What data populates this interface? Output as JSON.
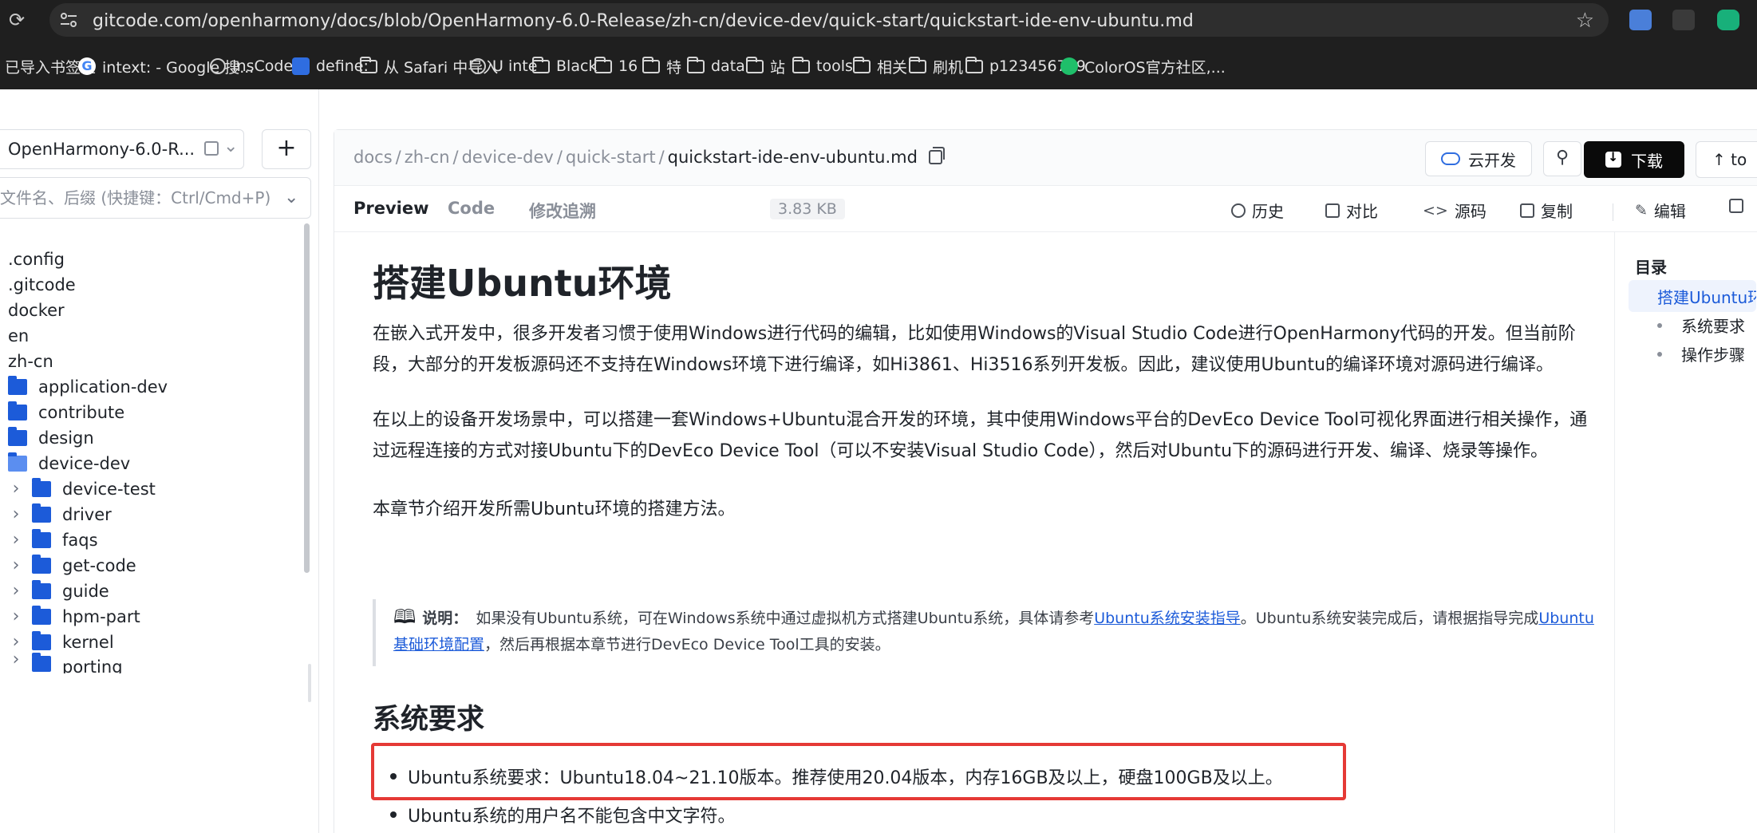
{
  "browser": {
    "url": "gitcode.com/openharmony/docs/blob/OpenHarmony-6.0-Release/zh-cn/device-dev/quick-start/quickstart-ide-env-ubuntu.md",
    "bookmarks": [
      {
        "label": "已导入书签栏",
        "icon": "none"
      },
      {
        "label": "intext: - Google 搜...",
        "icon": "google"
      },
      {
        "label": "InsCodeAI",
        "icon": "globe"
      },
      {
        "label": "define:",
        "icon": "dict"
      },
      {
        "label": "从 Safari 中导入",
        "icon": "folder"
      },
      {
        "label": "U inte",
        "icon": "globe"
      },
      {
        "label": "Black",
        "icon": "folder"
      },
      {
        "label": "16",
        "icon": "folder"
      },
      {
        "label": "特",
        "icon": "folder"
      },
      {
        "label": "data",
        "icon": "folder"
      },
      {
        "label": "站",
        "icon": "folder"
      },
      {
        "label": "tools",
        "icon": "folder"
      },
      {
        "label": "相关",
        "icon": "folder"
      },
      {
        "label": "刷机",
        "icon": "folder"
      },
      {
        "label": "p123456789",
        "icon": "folder"
      },
      {
        "label": "ColorOS官方社区,...",
        "icon": "coloros"
      }
    ]
  },
  "sidebar": {
    "repo_label": "OpenHarmony-6.0-R...",
    "add_label": "+",
    "search_placeholder": "文件名、后缀 (快捷键：Ctrl/Cmd+P)",
    "items": [
      {
        "label": ".config",
        "type": "file",
        "indent": 0
      },
      {
        "label": ".gitcode",
        "type": "file",
        "indent": 0
      },
      {
        "label": "docker",
        "type": "file",
        "indent": 0
      },
      {
        "label": "en",
        "type": "file",
        "indent": 0
      },
      {
        "label": "zh-cn",
        "type": "file",
        "indent": 0
      },
      {
        "label": "application-dev",
        "type": "folder",
        "indent": 0
      },
      {
        "label": "contribute",
        "type": "folder",
        "indent": 0
      },
      {
        "label": "design",
        "type": "folder",
        "indent": 0
      },
      {
        "label": "device-dev",
        "type": "folder-open",
        "indent": 0
      },
      {
        "label": "device-test",
        "type": "folder",
        "indent": 1
      },
      {
        "label": "driver",
        "type": "folder",
        "indent": 1
      },
      {
        "label": "faqs",
        "type": "folder",
        "indent": 1
      },
      {
        "label": "get-code",
        "type": "folder",
        "indent": 1
      },
      {
        "label": "guide",
        "type": "folder",
        "indent": 1
      },
      {
        "label": "hpm-part",
        "type": "folder",
        "indent": 1
      },
      {
        "label": "kernel",
        "type": "folder",
        "indent": 1
      },
      {
        "label": "porting",
        "type": "folder",
        "indent": 1
      }
    ]
  },
  "header": {
    "crumbs": [
      "docs",
      "zh-cn",
      "device-dev",
      "quick-start"
    ],
    "current_file": "quickstart-ide-env-ubuntu.md",
    "cloud_label": "云开发",
    "download_label": "下载",
    "to_label": "to"
  },
  "tabs": {
    "preview": "Preview",
    "code": "Code",
    "blame": "修改追溯",
    "size": "3.83 KB",
    "history": "历史",
    "compare": "对比",
    "source": "源码",
    "copy": "复制",
    "edit": "编辑"
  },
  "article": {
    "title": "搭建Ubuntu环境",
    "para1": "在嵌入式开发中，很多开发者习惯于使用Windows进行代码的编辑，比如使用Windows的Visual Studio Code进行OpenHarmony代码的开发。但当前阶段，大部分的开发板源码还不支持在Windows环境下进行编译，如Hi3861、Hi3516系列开发板。因此，建议使用Ubuntu的编译环境对源码进行编译。",
    "para2": "在以上的设备开发场景中，可以搭建一套Windows+Ubuntu混合开发的环境，其中使用Windows平台的DevEco Device Tool可视化界面进行相关操作，通过远程连接的方式对接Ubuntu下的DevEco Device Tool（可以不安装Visual Studio Code），然后对Ubuntu下的源码进行开发、编译、烧录等操作。",
    "para3": "本章节介绍开发所需Ubuntu环境的搭建方法。",
    "note_label": "说明：",
    "note_text1": "如果没有Ubuntu系统，可在Windows系统中通过虚拟机方式搭建Ubuntu系统，具体请参考",
    "note_link1": "Ubuntu系统安装指导",
    "note_text2": "。Ubuntu系统安装完成后，请根据指导完成",
    "note_link2": "Ubuntu基础环境配置",
    "note_text3": "，然后再根据本章节进行DevEco Device Tool工具的安装。",
    "section_title": "系统要求",
    "bullet1": "Ubuntu系统要求：Ubuntu18.04~21.10版本。推荐使用20.04版本，内存16GB及以上，硬盘100GB及以上。",
    "bullet2": "Ubuntu系统的用户名不能包含中文字符。"
  },
  "toc": {
    "title": "目录",
    "items": [
      "搭建Ubuntu环境",
      "系统要求",
      "操作步骤"
    ]
  },
  "colors": {
    "accent": "#1c5bd9",
    "highlight": "#e53935",
    "chrome_bg": "#1f1f1f"
  }
}
